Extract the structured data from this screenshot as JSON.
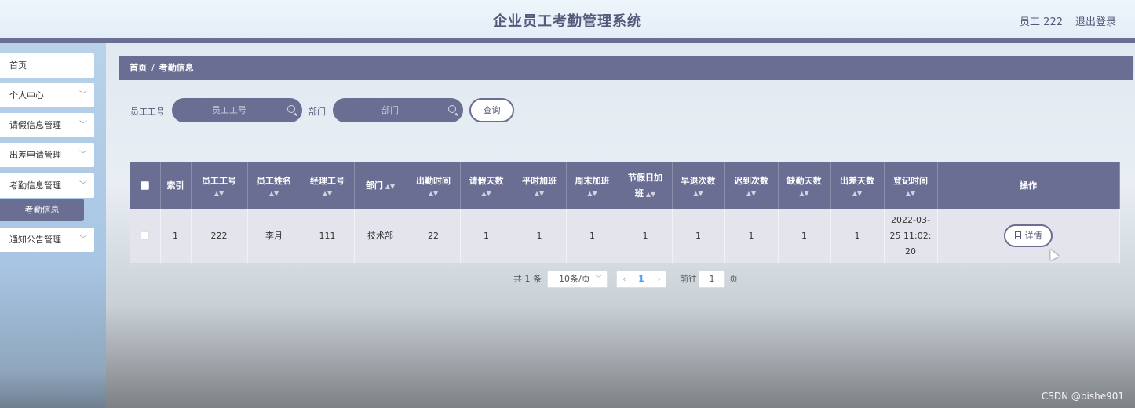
{
  "header": {
    "title": "企业员工考勤管理系统",
    "user": "员工 222",
    "logout": "退出登录"
  },
  "sidebar": {
    "items": [
      {
        "label": "首页",
        "has_chevron": false
      },
      {
        "label": "个人中心",
        "has_chevron": true
      },
      {
        "label": "请假信息管理",
        "has_chevron": true
      },
      {
        "label": "出差申请管理",
        "has_chevron": true
      },
      {
        "label": "考勤信息管理",
        "has_chevron": true
      },
      {
        "label": "通知公告管理",
        "has_chevron": true
      }
    ],
    "active_sub": "考勤信息"
  },
  "breadcrumb": {
    "home": "首页",
    "separator": "/",
    "current": "考勤信息"
  },
  "search": {
    "emp_no_label": "员工工号",
    "emp_no_placeholder": "员工工号",
    "dept_label": "部门",
    "dept_placeholder": "部门",
    "query_button": "查询"
  },
  "table": {
    "headers": {
      "index": "索引",
      "emp_no": "员工工号",
      "emp_name": "员工姓名",
      "mgr_no": "经理工号",
      "dept": "部门",
      "attend_days": "出勤时间",
      "leave_days": "请假天数",
      "weekday_ot": "平时加班",
      "weekend_ot": "周末加班",
      "holiday_ot_1": "节假日加",
      "holiday_ot_2": "班",
      "early_leave": "早退次数",
      "late": "迟到次数",
      "absent": "缺勤天数",
      "business_trip": "出差天数",
      "register_time": "登记时间",
      "actions": "操作"
    },
    "rows": [
      {
        "index": "1",
        "emp_no": "222",
        "emp_name": "李月",
        "mgr_no": "111",
        "dept": "技术部",
        "attend_days": "22",
        "leave_days": "1",
        "weekday_ot": "1",
        "weekend_ot": "1",
        "holiday_ot": "1",
        "early_leave": "1",
        "late": "1",
        "absent": "1",
        "business_trip": "1",
        "register_time_1": "2022-03-",
        "register_time_2": "25 11:02:",
        "register_time_3": "20",
        "detail_button": "详情"
      }
    ]
  },
  "pagination": {
    "total": "共 1 条",
    "page_size": "10条/页",
    "current_page": "1",
    "goto_label": "前往",
    "goto_value": "1",
    "page_suffix": "页"
  },
  "watermark": "CSDN @bishe901",
  "colors": {
    "primary": "#6a6e92",
    "header_bg": "#eef5fb",
    "sidebar_bg": "#b8d2ea",
    "row_bg": "#e4e5ec",
    "page_active": "#409eff"
  }
}
